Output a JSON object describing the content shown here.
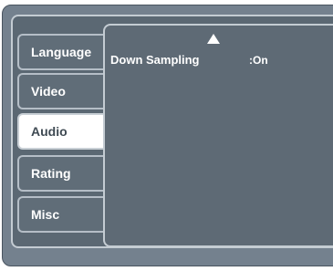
{
  "tabs": [
    {
      "label": "Language"
    },
    {
      "label": "Video"
    },
    {
      "label": "Audio"
    },
    {
      "label": "Rating"
    },
    {
      "label": "Misc"
    }
  ],
  "active_tab": "Audio",
  "panel": {
    "setting_label": "Down Sampling",
    "setting_value": ":On"
  },
  "colors": {
    "frame": "#74818e",
    "tab": "#606d78",
    "panel": "#5e6a75",
    "active_tab": "#ffffff",
    "text": "#ffffff"
  },
  "icons": {
    "scroll_up": "up-arrow-icon"
  }
}
